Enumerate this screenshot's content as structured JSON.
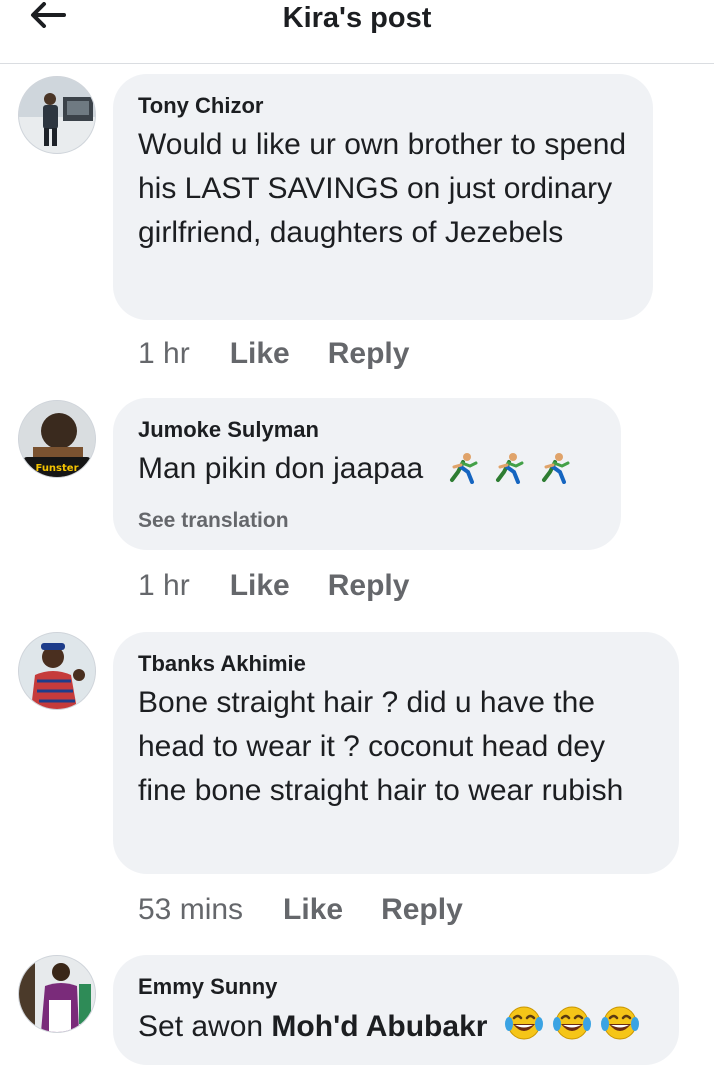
{
  "header": {
    "title": "Kira's post",
    "back_icon": "arrow-left-icon"
  },
  "comments": [
    {
      "author": "Tony Chizor",
      "text": "Would u like ur own brother to spend his LAST SAVINGS on just ordinary girlfriend, daughters of Jezebels",
      "time": "1 hr",
      "like_label": "Like",
      "reply_label": "Reply"
    },
    {
      "author": "Jumoke Sulyman",
      "text": "Man pikin don jaapaa",
      "emojis": [
        "person-running-emoji",
        "person-running-emoji",
        "person-running-emoji"
      ],
      "see_translation": "See translation",
      "time": "1 hr",
      "like_label": "Like",
      "reply_label": "Reply",
      "avatar_sticker": "Funster"
    },
    {
      "author": "Tbanks Akhimie",
      "text": "Bone straight hair ? did u have the head to wear it ? coconut head dey fine bone straight hair to wear rubish",
      "time": "53 mins",
      "like_label": "Like",
      "reply_label": "Reply"
    },
    {
      "author": "Emmy Sunny",
      "text_prefix": "Set awon ",
      "mention": "Moh'd Abubakr",
      "emojis": [
        "tears-of-joy-emoji",
        "tears-of-joy-emoji",
        "tears-of-joy-emoji"
      ]
    }
  ],
  "colors": {
    "bubble": "#f0f2f5",
    "secondary_text": "#65676b",
    "primary_text": "#1c1e21",
    "divider": "#dadde1"
  }
}
